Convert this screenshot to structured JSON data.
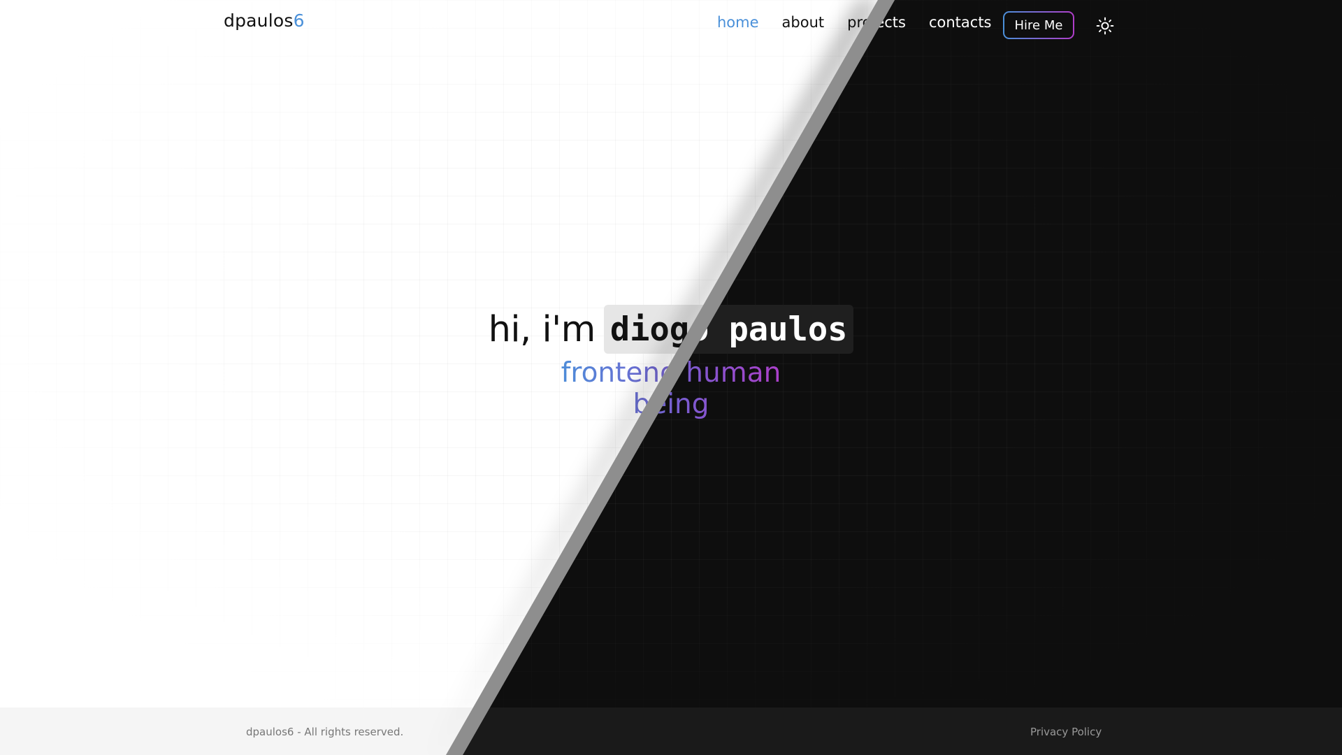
{
  "header": {
    "logo_text": "dpaulos",
    "logo_accent": "6",
    "nav": [
      {
        "label": "home",
        "active": true
      },
      {
        "label": "about",
        "active": false
      },
      {
        "label": "projects",
        "active": false
      },
      {
        "label": "contacts",
        "active": false
      }
    ],
    "hire_label": "Hire Me",
    "theme_icon": "sun-icon"
  },
  "hero": {
    "greeting": "hi, i'm",
    "name": "diogo paulos",
    "subtitle": "frontend human being"
  },
  "footer": {
    "copyright": "dpaulos6 - All rights reserved.",
    "privacy": "Privacy Policy"
  },
  "colors": {
    "accent": "#4a90d9",
    "gradient_end": "#b03dc9",
    "light_bg": "#ffffff",
    "dark_bg": "#0e0e0e",
    "divider": "#8e8e8e"
  }
}
